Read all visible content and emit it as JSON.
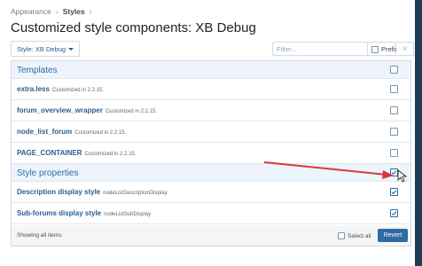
{
  "breadcrumb": {
    "items": [
      "Appearance",
      "Styles"
    ],
    "separator": "›"
  },
  "page": {
    "title": "Customized style components: XB Debug"
  },
  "toolbar": {
    "style_button_label": "Style: XB Debug",
    "filter_placeholder": "Filter...",
    "filter_value": "",
    "prefix_label": "Prefix",
    "clear_glyph": "✕"
  },
  "sections": {
    "templates": {
      "label": "Templates",
      "items": [
        {
          "name": "extra.less",
          "note": "Customized in 2.2.15."
        },
        {
          "name": "forum_overview_wrapper",
          "note": "Customized in 2.2.15."
        },
        {
          "name": "node_list_forum",
          "note": "Customized in 2.2.15."
        },
        {
          "name": "PAGE_CONTAINER",
          "note": "Customized in 2.2.15."
        }
      ]
    },
    "style_properties": {
      "label": "Style properties",
      "items": [
        {
          "name": "Description display style",
          "note": "nodeListDescriptionDisplay",
          "checked": true
        },
        {
          "name": "Sub-forums display style",
          "note": "nodeListSubDisplay",
          "checked": true
        }
      ]
    }
  },
  "footer": {
    "status_text": "Showing all items",
    "select_all_label": "Select all",
    "revert_label": "Revert"
  },
  "colors": {
    "accent": "#2f6aa3",
    "link": "#2b5d8c",
    "section_bg": "#edf4fb",
    "annotation_arrow": "#d9383a",
    "side_strip": "#1f3b57"
  },
  "icons": {
    "style_caret": "caret-down-icon",
    "checkbox_checked": "check-icon",
    "annotation": "red-arrow-icon",
    "cursor": "mouse-pointer-icon"
  }
}
